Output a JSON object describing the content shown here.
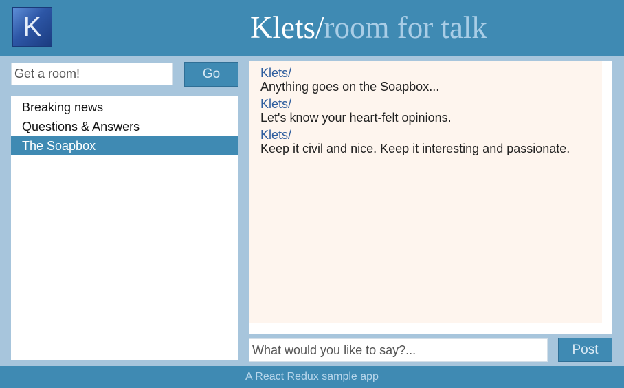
{
  "header": {
    "logo_letter": "K",
    "brand": "Klets/",
    "tagline": "room for talk"
  },
  "rooms": {
    "search_placeholder": "Get a room!",
    "go_label": "Go",
    "items": [
      {
        "label": "Breaking news"
      },
      {
        "label": "Questions & Answers"
      },
      {
        "label": "The Soapbox"
      }
    ],
    "selected": "The Soapbox"
  },
  "messages": [
    {
      "author": "Klets/",
      "text": "Anything goes on the Soapbox..."
    },
    {
      "author": "Klets/",
      "text": "Let's know your heart-felt opinions."
    },
    {
      "author": "Klets/",
      "text": "Keep it civil and nice. Keep it interesting and passionate."
    }
  ],
  "composer": {
    "placeholder": "What would you like to say?...",
    "post_label": "Post"
  },
  "footer": {
    "text": "A React Redux sample app"
  },
  "colors": {
    "primary": "#3f8ab3",
    "background": "#a7c5dc",
    "message_panel": "#fef5ee",
    "author": "#2f5e9e"
  }
}
